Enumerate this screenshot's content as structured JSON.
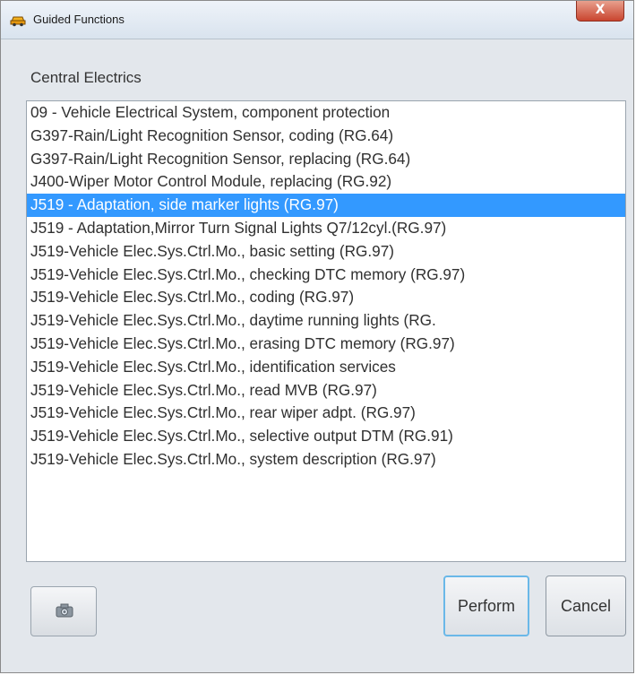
{
  "window": {
    "title": "Guided Functions",
    "close_label": "X"
  },
  "section": {
    "label": "Central Electrics"
  },
  "functions_list": {
    "selected_index": 4,
    "items": [
      "09 - Vehicle Electrical System, component protection",
      "G397-Rain/Light Recognition Sensor, coding (RG.64)",
      "G397-Rain/Light Recognition Sensor, replacing (RG.64)",
      "J400-Wiper Motor Control Module, replacing (RG.92)",
      "J519 - Adaptation, side marker lights (RG.97)",
      "J519 - Adaptation,Mirror Turn Signal Lights Q7/12cyl.(RG.97)",
      "J519-Vehicle Elec.Sys.Ctrl.Mo., basic setting (RG.97)",
      "J519-Vehicle Elec.Sys.Ctrl.Mo., checking DTC memory (RG.97)",
      "J519-Vehicle Elec.Sys.Ctrl.Mo., coding (RG.97)",
      "J519-Vehicle Elec.Sys.Ctrl.Mo., daytime running lights (RG.",
      "J519-Vehicle Elec.Sys.Ctrl.Mo., erasing DTC memory (RG.97)",
      "J519-Vehicle Elec.Sys.Ctrl.Mo., identification services",
      "J519-Vehicle Elec.Sys.Ctrl.Mo., read MVB (RG.97)",
      "J519-Vehicle Elec.Sys.Ctrl.Mo., rear wiper adpt. (RG.97)",
      "J519-Vehicle Elec.Sys.Ctrl.Mo., selective output DTM (RG.91)",
      "J519-Vehicle Elec.Sys.Ctrl.Mo., system description (RG.97)"
    ]
  },
  "buttons": {
    "perform_label": "Perform",
    "cancel_label": "Cancel",
    "screenshot_icon": "camera-icon"
  },
  "colors": {
    "selection": "#3399ff",
    "close_button": "#c9452f"
  }
}
